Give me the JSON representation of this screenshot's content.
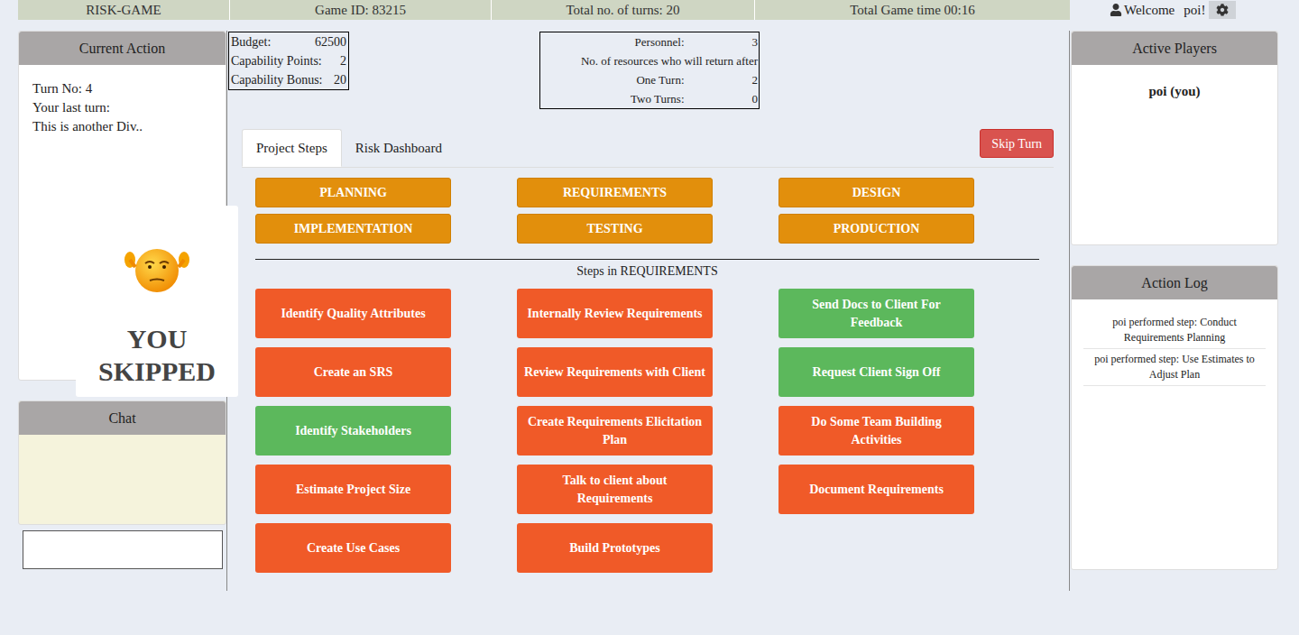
{
  "topbar": {
    "app_name": "RISK-GAME",
    "game_id": "Game ID: 83215",
    "turns": "Total no. of turns: 20",
    "time": "Total Game time 00:16",
    "welcome": "Welcome",
    "user": "poi!"
  },
  "current_action": {
    "title": "Current Action",
    "lines": [
      "Turn No: 4",
      "Your last turn:",
      "This is another Div.."
    ],
    "overlay": [
      "YOU",
      "SKIPPED"
    ]
  },
  "chat": {
    "title": "Chat"
  },
  "budget": [
    {
      "label": "Budget:",
      "value": "62500"
    },
    {
      "label": "Capability Points:",
      "value": "2"
    },
    {
      "label": "Capability Bonus:",
      "value": "20"
    }
  ],
  "personnel": {
    "rows": [
      {
        "label": "Personnel:",
        "value": "3"
      }
    ],
    "subheading": "No. of resources who will return after",
    "return_rows": [
      {
        "label": "One Turn:",
        "value": "2"
      },
      {
        "label": "Two Turns:",
        "value": "0"
      }
    ]
  },
  "tabs": [
    {
      "label": "Project Steps",
      "selected": true
    },
    {
      "label": "Risk Dashboard",
      "selected": false
    }
  ],
  "skip_button": "Skip Turn",
  "phases": [
    "PLANNING",
    "REQUIREMENTS",
    "DESIGN",
    "IMPLEMENTATION",
    "TESTING",
    "PRODUCTION"
  ],
  "steps_heading": "Steps in REQUIREMENTS",
  "steps": [
    {
      "label": "Identify Quality Attributes",
      "completed": false
    },
    {
      "label": "Internally Review Requirements",
      "completed": false
    },
    {
      "label": "Send Docs to Client For Feedback",
      "completed": true
    },
    {
      "label": "Create an SRS",
      "completed": false
    },
    {
      "label": "Review Requirements with Client",
      "completed": false
    },
    {
      "label": "Request Client Sign Off",
      "completed": true
    },
    {
      "label": "Identify Stakeholders",
      "completed": true
    },
    {
      "label": "Create Requirements Elicitation Plan",
      "completed": false
    },
    {
      "label": "Do Some Team Building Activities",
      "completed": false
    },
    {
      "label": "Estimate Project Size",
      "completed": false
    },
    {
      "label": "Talk to client about Requirements",
      "completed": false
    },
    {
      "label": "Document Requirements",
      "completed": false
    },
    {
      "label": "Create Use Cases",
      "completed": false
    },
    {
      "label": "Build Prototypes",
      "completed": false
    }
  ],
  "active_players": {
    "title": "Active Players",
    "players": [
      "poi (you)"
    ]
  },
  "action_log": {
    "title": "Action Log",
    "entries": [
      "poi performed step: Conduct Requirements Planning",
      "poi performed step: Use Estimates to Adjust Plan"
    ]
  }
}
